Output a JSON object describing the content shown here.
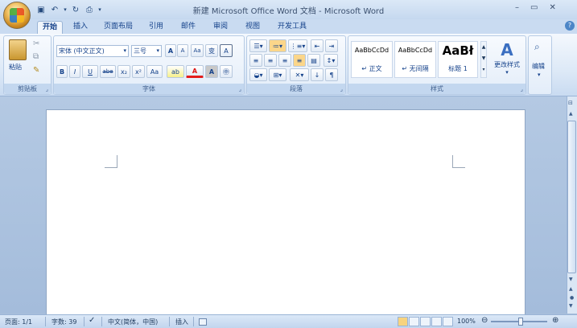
{
  "window": {
    "title": "新建 Microsoft Office Word 文档 - Microsoft Word",
    "controls": [
      "–",
      "▭",
      "✕"
    ]
  },
  "qat": {
    "icons": [
      "save-icon",
      "undo-icon",
      "redo-icon",
      "print-preview-icon",
      "customize-icon"
    ],
    "glyphs": [
      "▣",
      "↶",
      "▾",
      "↻",
      "⎙",
      "▾"
    ]
  },
  "tabs": [
    {
      "label": "开始",
      "active": true
    },
    {
      "label": "插入"
    },
    {
      "label": "页面布局"
    },
    {
      "label": "引用"
    },
    {
      "label": "邮件"
    },
    {
      "label": "审阅"
    },
    {
      "label": "视图"
    },
    {
      "label": "开发工具"
    }
  ],
  "clipboard": {
    "paste_label": "粘贴",
    "group_label": "剪贴板"
  },
  "font": {
    "font_name": "宋体 (中文正文)",
    "font_size": "三号",
    "buttons_row1": [
      "A",
      "A",
      "Aa",
      "变",
      "A"
    ],
    "buttons_row2": [
      "B",
      "I",
      "U",
      "abe",
      "x₂",
      "x²",
      "Aa"
    ],
    "highlight_glyph": "ab",
    "color_glyph": "A",
    "char_shading": "A",
    "encircle": "㊥",
    "group_label": "字体"
  },
  "paragraph": {
    "group_label": "段落"
  },
  "styles": {
    "items": [
      {
        "preview": "AaBbCcDd",
        "name": "↵ 正文"
      },
      {
        "preview": "AaBbCcDd",
        "name": "↵ 无间隔"
      },
      {
        "preview": "AaBł",
        "name": "标题 1"
      }
    ],
    "change_styles_label": "更改样式",
    "group_label": "样式"
  },
  "editing": {
    "label": "编辑"
  },
  "statusbar": {
    "page": "页面: 1/1",
    "words": "字数: 39",
    "language": "中文(简体，中国)",
    "insert_mode": "插入",
    "zoom": "100%"
  },
  "colors": {
    "accent": "#15428b",
    "ribbon": "#dde9f7",
    "workspace": "#a8bfdb"
  }
}
